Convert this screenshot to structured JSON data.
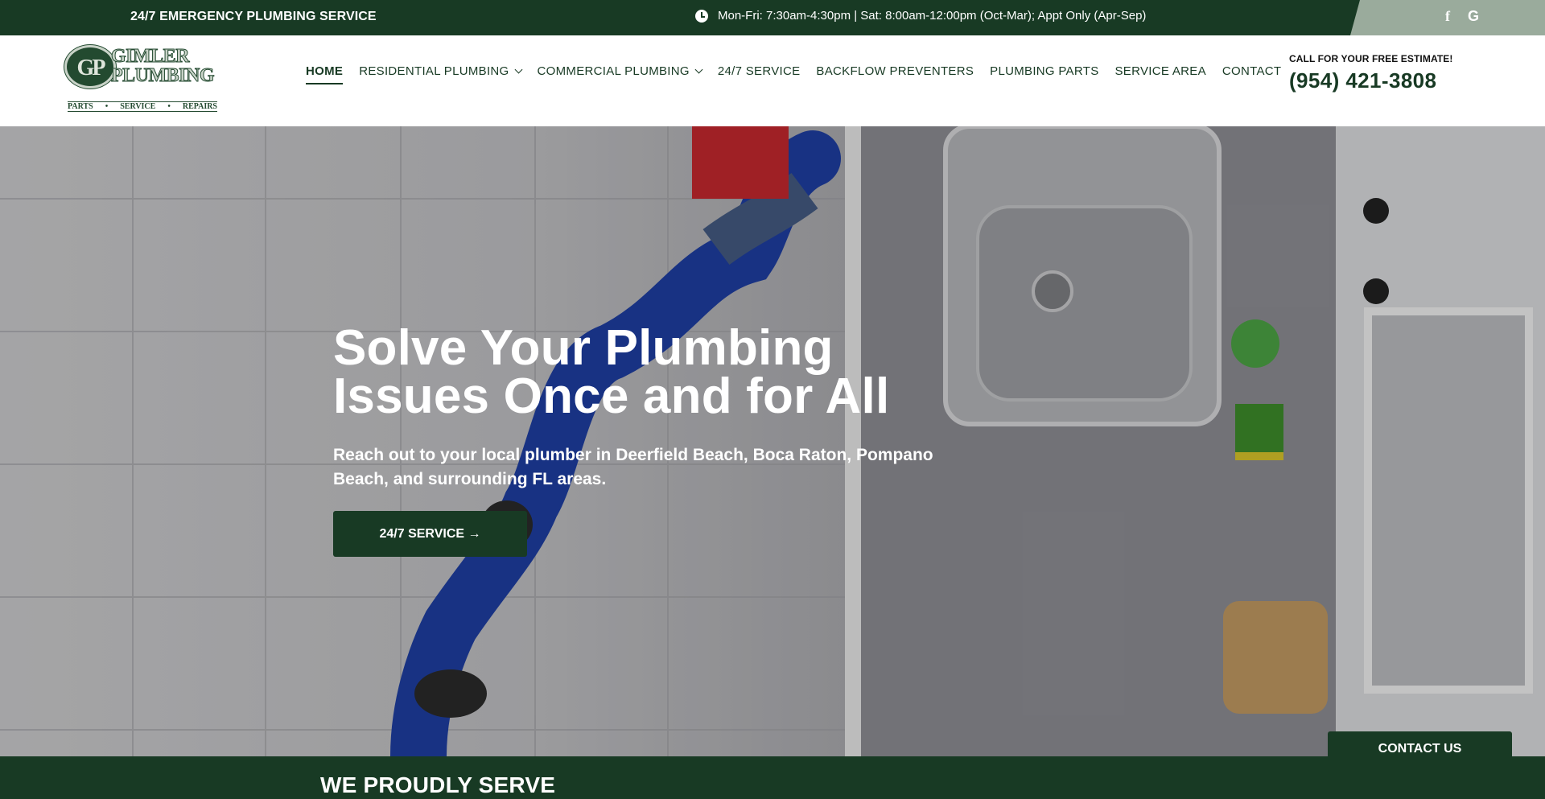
{
  "topbar": {
    "emergency": "24/7 EMERGENCY PLUMBING SERVICE",
    "hours": "Mon-Fri: 7:30am-4:30pm | Sat: 8:00am-12:00pm (Oct-Mar); Appt Only (Apr-Sep)",
    "social": [
      {
        "icon": "facebook-icon",
        "label": "f"
      },
      {
        "icon": "google-icon",
        "label": "G"
      }
    ]
  },
  "logo": {
    "monogram": "GP",
    "line1": "GIMLER",
    "line2": "PLUMBING",
    "tagline": [
      "PARTS",
      "SERVICE",
      "REPAIRS"
    ]
  },
  "nav": {
    "items": [
      {
        "label": "HOME",
        "active": true,
        "dropdown": false
      },
      {
        "label": "RESIDENTIAL PLUMBING",
        "active": false,
        "dropdown": true
      },
      {
        "label": "COMMERCIAL PLUMBING",
        "active": false,
        "dropdown": true
      },
      {
        "label": "24/7 SERVICE",
        "active": false,
        "dropdown": false
      },
      {
        "label": "BACKFLOW PREVENTERS",
        "active": false,
        "dropdown": false
      },
      {
        "label": "PLUMBING PARTS",
        "active": false,
        "dropdown": false
      },
      {
        "label": "SERVICE AREA",
        "active": false,
        "dropdown": false
      },
      {
        "label": "CONTACT",
        "active": false,
        "dropdown": false
      }
    ]
  },
  "call": {
    "label": "CALL FOR YOUR FREE ESTIMATE!",
    "phone": "(954) 421-3808"
  },
  "hero": {
    "title": "Solve Your Plumbing Issues Once and for All",
    "subtitle": "Reach out to your local plumber in Deerfield Beach, Boca Raton, Pompano Beach, and surrounding FL areas.",
    "button": "24/7 SERVICE →"
  },
  "serve": {
    "title": "WE PROUDLY SERVE"
  },
  "contact_tab": {
    "label": "CONTACT US"
  },
  "colors": {
    "brand_green": "#183a24",
    "social_bg": "#9aab9c"
  }
}
